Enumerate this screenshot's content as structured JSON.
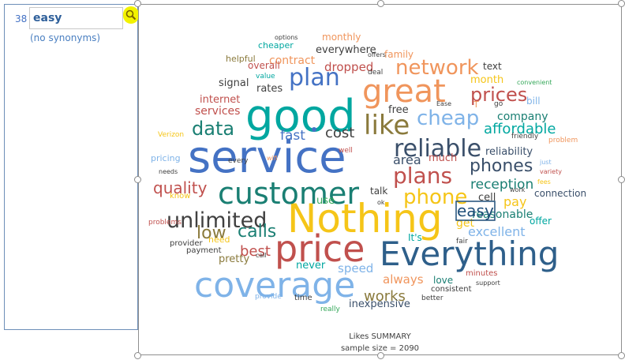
{
  "search": {
    "count": "38",
    "term": "easy",
    "synonyms_text": "(no synonyms)"
  },
  "chart": {
    "title": "Likes SUMMARY",
    "sample_size": "sample size = 2090"
  },
  "colors": {
    "blue": "#4472c4",
    "teal": "#00a7a0",
    "orange": "#f0955c",
    "yellow": "#f5c518",
    "red": "#c0504d",
    "navy": "#1f4e79",
    "gray": "#595959",
    "olive": "#8a7a3c",
    "lightblue": "#7fb3e8",
    "green": "#35a85a"
  },
  "chart_data": {
    "type": "wordcloud",
    "highlighted_word": "easy",
    "words": [
      {
        "text": "service",
        "color": "#4472c4"
      },
      {
        "text": "good",
        "color": "#00a7a0"
      },
      {
        "text": "Nothing",
        "color": "#f5c518"
      },
      {
        "text": "Everything",
        "color": "#2e5f8a"
      },
      {
        "text": "coverage",
        "color": "#7fb3e8"
      },
      {
        "text": "price",
        "color": "#c0504d"
      },
      {
        "text": "customer",
        "color": "#1a7f73"
      },
      {
        "text": "great",
        "color": "#f0955c"
      },
      {
        "text": "unlimited",
        "color": "#404040"
      },
      {
        "text": "plan",
        "color": "#4472c4"
      },
      {
        "text": "like",
        "color": "#8a7a3c"
      },
      {
        "text": "reliable",
        "color": "#3a4f6a"
      },
      {
        "text": "plans",
        "color": "#c0504d"
      },
      {
        "text": "phone",
        "color": "#f5c518"
      },
      {
        "text": "network",
        "color": "#f0955c"
      },
      {
        "text": "prices",
        "color": "#c0504d"
      },
      {
        "text": "cheap",
        "color": "#7fb3e8"
      },
      {
        "text": "data",
        "color": "#1a7f73"
      },
      {
        "text": "phones",
        "color": "#3a4f6a"
      },
      {
        "text": "affordable",
        "color": "#00a7a0"
      },
      {
        "text": "calls",
        "color": "#1a7f73"
      },
      {
        "text": "quality",
        "color": "#c0504d"
      },
      {
        "text": "low",
        "color": "#8a7a3c"
      },
      {
        "text": "works",
        "color": "#8a7a3c"
      },
      {
        "text": "best",
        "color": "#c0504d"
      },
      {
        "text": "excellent",
        "color": "#7fb3e8"
      },
      {
        "text": "reception",
        "color": "#1a7f73"
      },
      {
        "text": "reasonable",
        "color": "#1a7f73"
      },
      {
        "text": "fast",
        "color": "#4472c4"
      },
      {
        "text": "cost",
        "color": "#404040"
      },
      {
        "text": "dropped",
        "color": "#c0504d"
      },
      {
        "text": "easy",
        "color": "#1f4e79"
      },
      {
        "text": "speed",
        "color": "#7fb3e8"
      },
      {
        "text": "always",
        "color": "#f0955c"
      },
      {
        "text": "pay",
        "color": "#f5c518"
      },
      {
        "text": "get",
        "color": "#f5c518"
      },
      {
        "text": "area",
        "color": "#3a4f6a"
      },
      {
        "text": "reliability",
        "color": "#3a4f6a"
      },
      {
        "text": "company",
        "color": "#1a7f73"
      },
      {
        "text": "contract",
        "color": "#f0955c"
      },
      {
        "text": "everywhere",
        "color": "#404040"
      },
      {
        "text": "signal",
        "color": "#404040"
      },
      {
        "text": "rates",
        "color": "#404040"
      },
      {
        "text": "internet",
        "color": "#c0504d"
      },
      {
        "text": "services",
        "color": "#c0504d"
      },
      {
        "text": "inexpensive",
        "color": "#3a4f6a"
      },
      {
        "text": "connection",
        "color": "#3a4f6a"
      },
      {
        "text": "pretty",
        "color": "#8a7a3c"
      },
      {
        "text": "love",
        "color": "#1a7f73"
      },
      {
        "text": "month",
        "color": "#f5c518"
      },
      {
        "text": "family",
        "color": "#f0955c"
      },
      {
        "text": "monthly",
        "color": "#f0955c"
      },
      {
        "text": "free",
        "color": "#404040"
      },
      {
        "text": "much",
        "color": "#c0504d"
      },
      {
        "text": "cell",
        "color": "#404040"
      },
      {
        "text": "use",
        "color": "#35a85a"
      },
      {
        "text": "talk",
        "color": "#404040"
      },
      {
        "text": "never",
        "color": "#00a7a0"
      },
      {
        "text": "It's",
        "color": "#00a7a0"
      },
      {
        "text": "offer",
        "color": "#00a7a0"
      },
      {
        "text": "bill",
        "color": "#7fb3e8"
      },
      {
        "text": "text",
        "color": "#404040"
      },
      {
        "text": "overall",
        "color": "#c0504d"
      },
      {
        "text": "cheaper",
        "color": "#00a7a0"
      },
      {
        "text": "options",
        "color": "#404040"
      },
      {
        "text": "offers",
        "color": "#404040"
      },
      {
        "text": "helpful",
        "color": "#8a7a3c"
      },
      {
        "text": "value",
        "color": "#00a7a0"
      },
      {
        "text": "deal",
        "color": "#404040"
      },
      {
        "text": "convenient",
        "color": "#35a85a"
      },
      {
        "text": "Ease",
        "color": "#404040"
      },
      {
        "text": "go",
        "color": "#404040"
      },
      {
        "text": "T",
        "color": "#f0955c"
      },
      {
        "text": "friendly",
        "color": "#404040"
      },
      {
        "text": "problem",
        "color": "#f0955c"
      },
      {
        "text": "Verizon",
        "color": "#f5c518"
      },
      {
        "text": "pricing",
        "color": "#7fb3e8"
      },
      {
        "text": "every",
        "color": "#404040"
      },
      {
        "text": "wifi",
        "color": "#f0955c"
      },
      {
        "text": "well",
        "color": "#c0504d"
      },
      {
        "text": "needs",
        "color": "#404040"
      },
      {
        "text": "know",
        "color": "#f5c518"
      },
      {
        "text": "problems",
        "color": "#c0504d"
      },
      {
        "text": "need",
        "color": "#f5c518"
      },
      {
        "text": "provider",
        "color": "#404040"
      },
      {
        "text": "payment",
        "color": "#404040"
      },
      {
        "text": "call",
        "color": "#404040"
      },
      {
        "text": "ok",
        "color": "#404040"
      },
      {
        "text": "fair",
        "color": "#404040"
      },
      {
        "text": "minutes",
        "color": "#c0504d"
      },
      {
        "text": "support",
        "color": "#404040"
      },
      {
        "text": "consistent",
        "color": "#404040"
      },
      {
        "text": "better",
        "color": "#404040"
      },
      {
        "text": "time",
        "color": "#404040"
      },
      {
        "text": "provide",
        "color": "#7fb3e8"
      },
      {
        "text": "really",
        "color": "#35a85a"
      },
      {
        "text": "work",
        "color": "#404040"
      },
      {
        "text": "fees",
        "color": "#f5c518"
      },
      {
        "text": "variety",
        "color": "#c0504d"
      },
      {
        "text": "just",
        "color": "#7fb3e8"
      }
    ]
  }
}
